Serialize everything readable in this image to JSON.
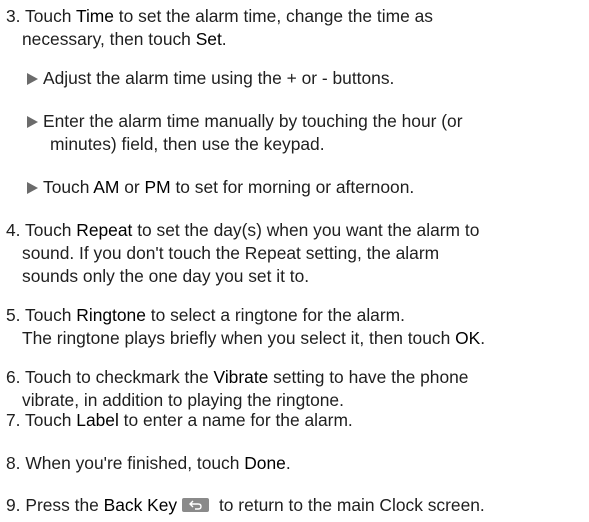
{
  "step3": {
    "num": "3.",
    "a": " Touch ",
    "b_time": "Time",
    "c": " to set the alarm time, change the time as",
    "d": "necessary, then touch ",
    "b_set": "Set",
    "e": ".",
    "bullets": [
      {
        "text": "Adjust the alarm time using the + or - buttons."
      },
      {
        "line1": "Enter the alarm time manually by touching the hour (or",
        "line2": "minutes) field, then use the keypad."
      },
      {
        "a": "Touch ",
        "b_am": "AM",
        "c": " or ",
        "b_pm": "PM",
        "d": " to set for morning or afternoon."
      }
    ]
  },
  "step4": {
    "num": "4.",
    "a": " Touch ",
    "b_repeat": "Repeat",
    "c": " to set the day(s) when you want the alarm to",
    "line2": "sound. If you don't touch the Repeat setting, the alarm",
    "line3": "sounds only the one day you set it to."
  },
  "step5": {
    "num": "5.",
    "a": " Touch ",
    "b_ringtone": "Ringtone",
    "c": " to select a ringtone for the alarm.",
    "d": "The ringtone plays briefly when you select it, then touch ",
    "b_ok": "OK",
    "e": "."
  },
  "step6": {
    "num": "6.",
    "a": " Touch to checkmark the ",
    "b_vibrate": "Vibrate",
    "c": " setting to have the phone",
    "line2": "vibrate, in addition to playing the ringtone."
  },
  "step7": {
    "num": "7.",
    "a": " Touch ",
    "b_label": "Label",
    "c": " to enter a name for the alarm."
  },
  "step8": {
    "num": "8.",
    "a": " When you're finished, touch ",
    "b_done": "Done",
    "c": "."
  },
  "step9": {
    "num": "9.",
    "a": " Press the ",
    "b_back": "Back Key",
    "c": " to return to the main Clock screen.",
    "back_icon": "back-arrow-icon"
  },
  "colors": {
    "text": "#1f1f1f",
    "bullet": "#6b6b6b",
    "key": "#8a8a8a"
  }
}
